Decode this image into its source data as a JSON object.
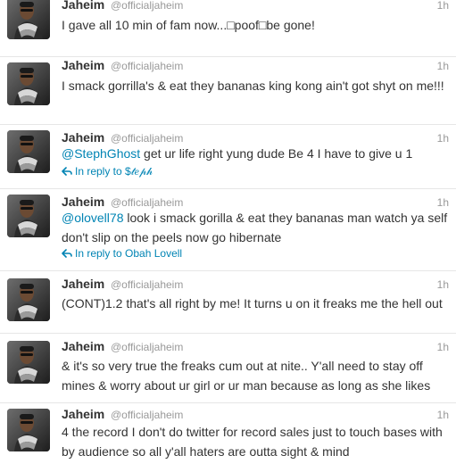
{
  "user": {
    "name": "Jaheim",
    "handle": "@officialjaheim"
  },
  "tweets": [
    {
      "time": "1h",
      "text": "I gave all 10 min of fam now...□poof□be gone!"
    },
    {
      "time": "1h",
      "text": "I smack gorrilla's & eat they bananas king kong ain't got shyt on me!!!"
    },
    {
      "time": "1h",
      "mention": "@StephGhost",
      "text": " get ur life right yung dude Be 4 I have to give u 1",
      "reply": "In reply to $𝓉𝑒𝓅𝒽"
    },
    {
      "time": "1h",
      "mention": "@olovell78",
      "text": " look i smack gorilla & eat they bananas man watch ya self don't slip on the peels now go hibernate",
      "reply": "In reply to Obah Lovell"
    },
    {
      "time": "1h",
      "text": "(CONT)1.2 that's all right by me! It turns u on it freaks me the hell out"
    },
    {
      "time": "1h",
      "text": "& it's so very true the freaks cum out at nite.. Y'all need to stay off mines & worry about ur girl or ur man because as long as she likes"
    },
    {
      "time": "1h",
      "text": "4 the record I don't do twitter for record sales just to touch bases with by audience so all y'all haters are outta sight & mind"
    }
  ],
  "colors": {
    "link": "#0084b4",
    "text": "#333333",
    "meta": "#999999"
  }
}
